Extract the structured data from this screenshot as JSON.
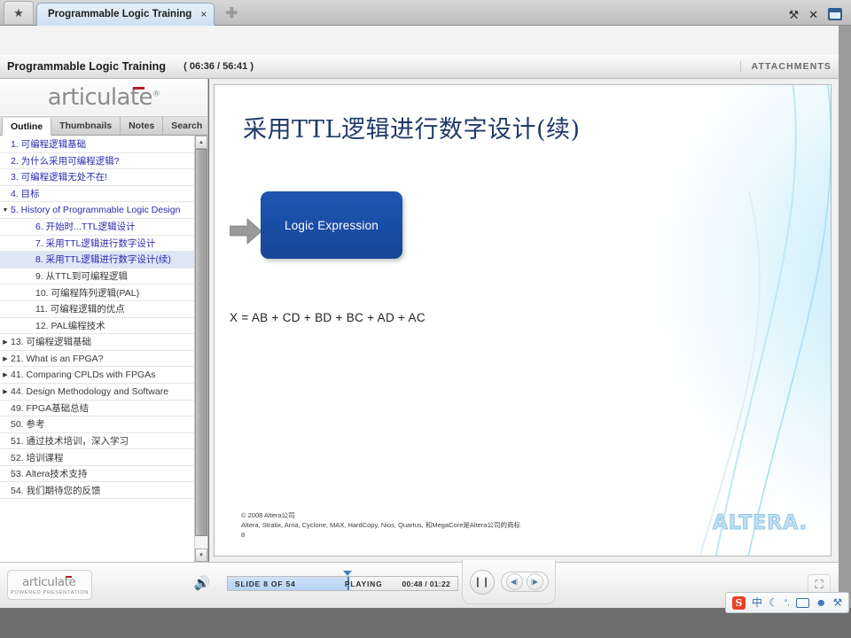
{
  "browser": {
    "star_icon": "star-icon",
    "tab_title": "Programmable Logic Training",
    "tab_close": "×",
    "new_tab": "✚",
    "wrench": "⚒",
    "close": "✕"
  },
  "player": {
    "title": "Programmable Logic Training",
    "time": "( 06:36 / 56:41 )",
    "attachments": "ATTACHMENTS",
    "logo": "articulate",
    "logo_sup": "®",
    "tabs": [
      {
        "label": "Outline",
        "active": true
      },
      {
        "label": "Thumbnails",
        "active": false
      },
      {
        "label": "Notes",
        "active": false
      },
      {
        "label": "Search",
        "active": false
      }
    ]
  },
  "outline": [
    {
      "num": "1.",
      "label": "可编程逻辑基础",
      "level": 0,
      "tri": "",
      "state": "link"
    },
    {
      "num": "2.",
      "label": "为什么采用可编程逻辑?",
      "level": 0,
      "tri": "",
      "state": "link"
    },
    {
      "num": "3.",
      "label": "可编程逻辑无处不在!",
      "level": 0,
      "tri": "",
      "state": "link"
    },
    {
      "num": "4.",
      "label": "目标",
      "level": 0,
      "tri": "",
      "state": "link"
    },
    {
      "num": "5.",
      "label": "History of Programmable Logic Design",
      "level": 0,
      "tri": "▼",
      "state": "link"
    },
    {
      "num": "6.",
      "label": "开始时...TTL逻辑设计",
      "level": 1,
      "tri": "",
      "state": "link"
    },
    {
      "num": "7.",
      "label": "采用TTL逻辑进行数字设计",
      "level": 1,
      "tri": "",
      "state": "link"
    },
    {
      "num": "8.",
      "label": "采用TTL逻辑进行数字设计(续)",
      "level": 1,
      "tri": "",
      "state": "selected"
    },
    {
      "num": "9.",
      "label": "从TTL到可编程逻辑",
      "level": 1,
      "tri": "",
      "state": "visited"
    },
    {
      "num": "10.",
      "label": "可编程阵列逻辑(PAL)",
      "level": 1,
      "tri": "",
      "state": "visited"
    },
    {
      "num": "11.",
      "label": "可编程逻辑的优点",
      "level": 1,
      "tri": "",
      "state": "visited"
    },
    {
      "num": "12.",
      "label": "PAL编程技术",
      "level": 1,
      "tri": "",
      "state": "visited"
    },
    {
      "num": "13.",
      "label": "可编程逻辑基础",
      "level": 0,
      "tri": "▶",
      "state": "visited"
    },
    {
      "num": "21.",
      "label": "What is an FPGA?",
      "level": 0,
      "tri": "▶",
      "state": "visited"
    },
    {
      "num": "41.",
      "label": "Comparing CPLDs with FPGAs",
      "level": 0,
      "tri": "▶",
      "state": "visited"
    },
    {
      "num": "44.",
      "label": "Design Methodology and Software",
      "level": 0,
      "tri": "▶",
      "state": "visited"
    },
    {
      "num": "49.",
      "label": "FPGA基础总结",
      "level": 0,
      "tri": "",
      "state": "visited"
    },
    {
      "num": "50.",
      "label": "参考",
      "level": 0,
      "tri": "",
      "state": "visited"
    },
    {
      "num": "51.",
      "label": "通过技术培训，深入学习",
      "level": 0,
      "tri": "",
      "state": "visited"
    },
    {
      "num": "52.",
      "label": "培训课程",
      "level": 0,
      "tri": "",
      "state": "visited"
    },
    {
      "num": "53.",
      "label": "Altera技术支持",
      "level": 0,
      "tri": "",
      "state": "visited"
    },
    {
      "num": "54.",
      "label": "我们期待您的反馈",
      "level": 0,
      "tri": "",
      "state": "visited"
    }
  ],
  "slide": {
    "title": "采用TTL逻辑进行数字设计(续)",
    "box_label": "Logic Expression",
    "formula": "X = AB + CD + BD + BC + AD + AC",
    "copyright": "© 2008 Altera公司",
    "trademark": "Altera, Stratix, Arria, Cyclone, MAX, HardCopy, Nios, Quartus, 和MegaCore是Altera公司的商标",
    "page_number": "8",
    "watermark": "ALTERA."
  },
  "controls": {
    "badge_logo": "articulate",
    "badge_sup": "·",
    "badge_sub": "POWERED PRESENTATION",
    "volume_icon": "🔊",
    "slide_counter": "SLIDE 8 OF 54",
    "state": "PLAYING",
    "time": "00:48 / 01:22",
    "pause_icon": "❙❙",
    "prev_icon": "◀|",
    "next_icon": "|▶",
    "fullscreen_icon": "⛶"
  },
  "ime": {
    "logo": "S",
    "mode": "中",
    "moon": "☾",
    "punct": "°,",
    "keyboard": "keyboard-icon",
    "person": "☻",
    "tools": "⚒"
  },
  "colors": {
    "accent_blue": "#1e56b4",
    "title_navy": "#1f3a68",
    "link_blue": "#2a2ab0",
    "brand_red": "#b0202f"
  }
}
